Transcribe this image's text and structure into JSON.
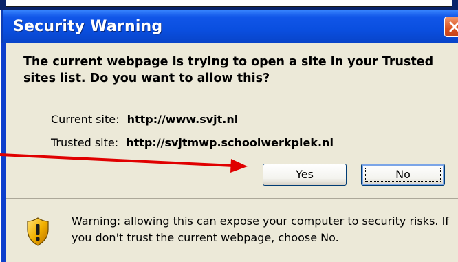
{
  "dialog": {
    "title": "Security Warning",
    "question": "The current webpage is trying to open a site in your Trusted sites list. Do you want to allow this?",
    "current_site_label": "Current site:",
    "current_site_value": "http://www.svjt.nl",
    "trusted_site_label": "Trusted site:",
    "trusted_site_value": "http://svjtmwp.schoolwerkplek.nl",
    "yes_label": "Yes",
    "no_label": "No",
    "warning_text": "Warning: allowing this can expose your computer to security risks. If you don't trust the current webpage, choose No."
  },
  "icons": {
    "close": "close-icon",
    "shield": "shield-warning-icon",
    "annotation": "red-arrow"
  },
  "colors": {
    "titlebar": "#0a4fe0",
    "client": "#ece9d8",
    "close_button": "#d9501e",
    "annotation_arrow": "#e00000",
    "shield": "#e8a800"
  }
}
